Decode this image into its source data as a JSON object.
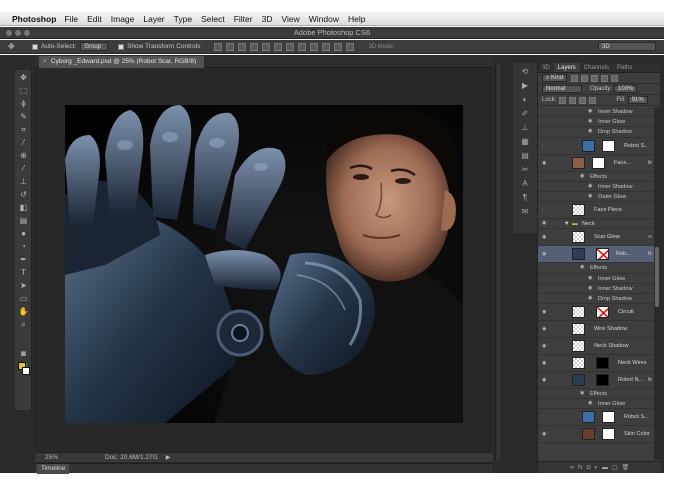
{
  "menubar": {
    "app": "Photoshop",
    "items": [
      "File",
      "Edit",
      "Image",
      "Layer",
      "Type",
      "Select",
      "Filter",
      "3D",
      "View",
      "Window",
      "Help"
    ]
  },
  "window": {
    "title": "Adobe Photoshop CS6"
  },
  "options_bar": {
    "auto_select_label": "Auto-Select:",
    "auto_select_value": "Group",
    "transform_controls_label": "Show Transform Controls",
    "mode_3d_label": "3D Mode:",
    "workspace_value": "3D"
  },
  "document": {
    "tab_title": "Cyborg _Edward.psd @ 25% (Robot Scar, RGB/8)",
    "zoom": "25%",
    "doc_size": "Doc: 20.6M/1.27G",
    "timeline_label": "Timeline"
  },
  "panel": {
    "tabs": [
      "3D",
      "Layers",
      "Channels",
      "Paths"
    ],
    "filter_kind": "Kind",
    "blend_mode": "Normal",
    "opacity_label": "Opacity:",
    "opacity_value": "100%",
    "lock_label": "Lock:",
    "fill_label": "Fill:",
    "fill_value": "91%",
    "fx_symbol": "fx",
    "effects_label": "Effects",
    "layers": [
      {
        "name": "Inner Shadow",
        "kind": "fx"
      },
      {
        "name": "Inner Glow",
        "kind": "fx"
      },
      {
        "name": "Drop Shadow",
        "kind": "fx"
      },
      {
        "name": "Robot S...",
        "kind": "layer-mask",
        "visible": false
      },
      {
        "name": "Face...",
        "kind": "layer-mask-fx",
        "visible": true
      },
      {
        "name": "Effects",
        "kind": "fxhdr"
      },
      {
        "name": "Inner Shadow",
        "kind": "fx"
      },
      {
        "name": "Outer Glow",
        "kind": "fx"
      },
      {
        "name": "Face Piece",
        "kind": "layer",
        "visible": false
      },
      {
        "name": "Neck",
        "kind": "group",
        "visible": true
      },
      {
        "name": "Scar Glow",
        "kind": "layer",
        "visible": true
      },
      {
        "name": "Rob...",
        "kind": "layer-mask-fx",
        "visible": true,
        "selected": true
      },
      {
        "name": "Effects",
        "kind": "fxhdr"
      },
      {
        "name": "Inner Glow",
        "kind": "fx"
      },
      {
        "name": "Inner Shadow",
        "kind": "fx"
      },
      {
        "name": "Drop Shadow",
        "kind": "fx"
      },
      {
        "name": "Circuit",
        "kind": "layer-mask",
        "visible": true
      },
      {
        "name": "Wire Shadow",
        "kind": "layer",
        "visible": true
      },
      {
        "name": "Neck Shadow",
        "kind": "layer",
        "visible": true
      },
      {
        "name": "Neck Wires",
        "kind": "layer-mask",
        "visible": true
      },
      {
        "name": "Robot N...",
        "kind": "layer-mask-fx",
        "visible": true
      },
      {
        "name": "Effects",
        "kind": "fxhdr"
      },
      {
        "name": "Inner Glow",
        "kind": "fx"
      },
      {
        "name": "Robot S...",
        "kind": "layer-mask",
        "visible": false
      },
      {
        "name": "Skin Color",
        "kind": "layer-mask",
        "visible": true
      }
    ]
  }
}
